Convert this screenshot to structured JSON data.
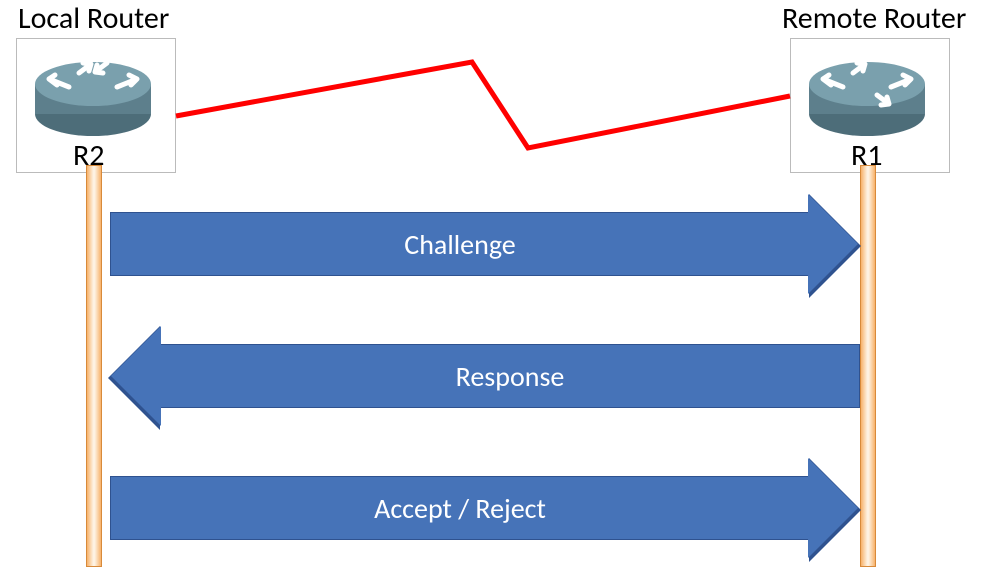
{
  "titles": {
    "local": "Local Router",
    "remote": "Remote Router"
  },
  "routers": {
    "left": {
      "label": "R2"
    },
    "right": {
      "label": "R1"
    }
  },
  "messages": {
    "m1": {
      "label": "Challenge",
      "direction": "right"
    },
    "m2": {
      "label": "Response",
      "direction": "left"
    },
    "m3": {
      "label": "Accept / Reject",
      "direction": "right"
    }
  },
  "colors": {
    "arrow_fill": "#4673b8",
    "arrow_border": "#2f528f",
    "link": "#ff0000",
    "router_body": "#5d7f8c",
    "router_top": "#7aa0ad"
  }
}
